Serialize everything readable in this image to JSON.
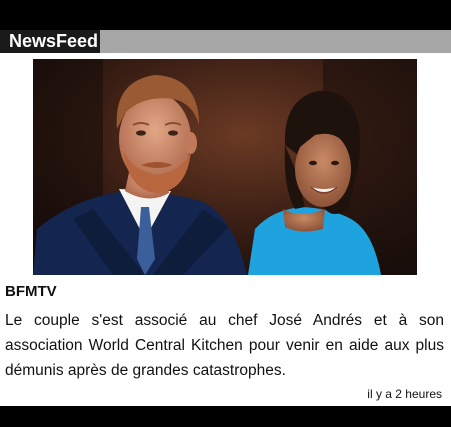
{
  "header": {
    "title": "NewsFeed"
  },
  "article": {
    "image_alt": "Harry et Meghan",
    "source": "BFMTV",
    "text": "Le couple s'est associé au chef José Andrés et à son association World Central Kitchen pour venir en aide aux plus démunis après de grandes catastrophes.",
    "timestamp": "il y a 2 heures"
  },
  "colors": {
    "header_bar": "#a6a6a6",
    "header_title_bg": "#1a1a1a",
    "panel_bg": "#ffffff",
    "frame_bg": "#000000"
  }
}
